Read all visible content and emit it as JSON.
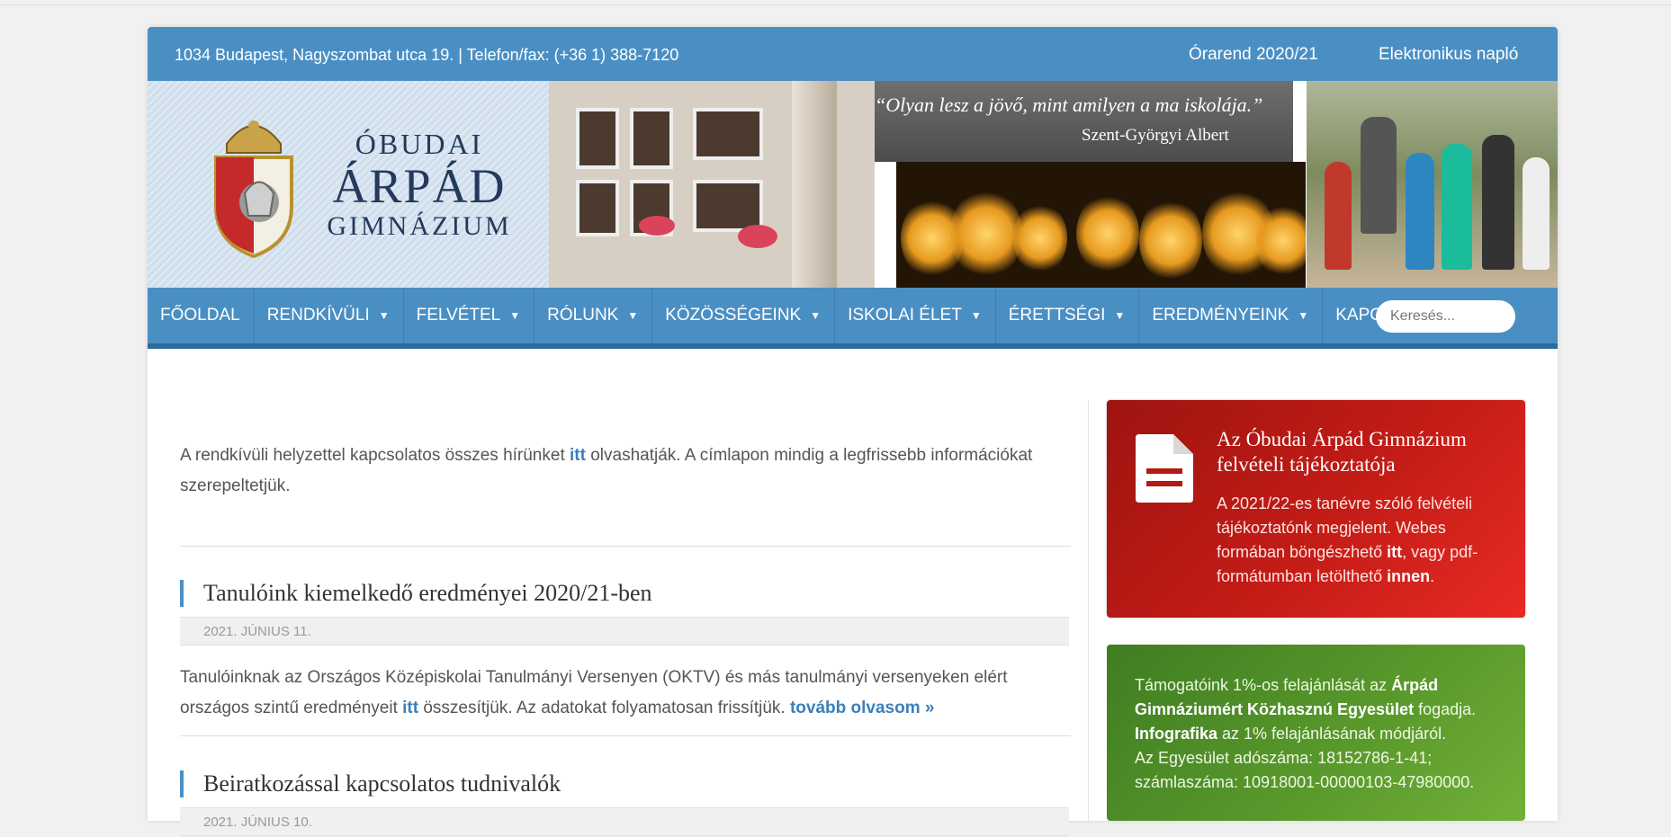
{
  "topbar": {
    "address": "1034 Budapest, Nagyszombat utca 19. | Telefon/fax: (+36 1) 388-7120",
    "timetable_link": "Órarend 2020/21",
    "diary_link": "Elektronikus napló"
  },
  "banner": {
    "logo_line1": "Óbudai",
    "logo_line2": "Árpád",
    "logo_line3": "Gimnázium",
    "quote": "“Olyan lesz a jövő, mint amilyen a ma iskolája.”",
    "quote_author": "Szent-Györgyi Albert"
  },
  "nav": {
    "items": [
      {
        "label": "FŐOLDAL",
        "dropdown": false
      },
      {
        "label": "RENDKÍVÜLI",
        "dropdown": true
      },
      {
        "label": "FELVÉTEL",
        "dropdown": true
      },
      {
        "label": "RÓLUNK",
        "dropdown": true
      },
      {
        "label": "KÖZÖSSÉGEINK",
        "dropdown": true
      },
      {
        "label": "ISKOLAI ÉLET",
        "dropdown": true
      },
      {
        "label": "ÉRETTSÉGI",
        "dropdown": true
      },
      {
        "label": "EREDMÉNYEINK",
        "dropdown": true
      },
      {
        "label": "KAPCSOLAT",
        "dropdown": false
      }
    ],
    "search_placeholder": "Keresés..."
  },
  "main": {
    "intro_before": "A rendkívüli helyzettel kapcsolatos összes hírünket ",
    "intro_link": "itt",
    "intro_after": " olvashatják. A címlapon mindig a legfrissebb információkat szerepeltetjük.",
    "posts": [
      {
        "title": "Tanulóink kiemelkedő eredményei 2020/21-ben",
        "date": "2021. JÚNIUS 11.",
        "body_before": "Tanulóinknak az Országos Középiskolai Tanulmányi Versenyen (OKTV) és más tanulmányi versenyeken elért országos szintű eredményeit ",
        "body_link": "itt",
        "body_after": " összesítjük. Az adatokat folyamatosan frissítjük. ",
        "more": "tovább olvasom »"
      },
      {
        "title": "Beiratkozással kapcsolatos tudnivalók",
        "date": "2021. JÚNIUS 10."
      }
    ]
  },
  "sidebar": {
    "admission_box": {
      "title": "Az Óbudai Árpád Gimnázium felvételi tájékoztatója",
      "text_before": "A 2021/22-es tanévre szóló felvételi tájékoztatónk megjelent. Webes formában böngészhető ",
      "link1": "itt",
      "text_mid": ", vagy pdf-formátumban letölthető ",
      "link2": "innen",
      "text_end": "."
    },
    "support_box": {
      "text1": "Támogatóink 1%-os felajánlását az ",
      "org": "Árpád Gimnáziumért Közhasznú Egyesület",
      "text2": " fogadja.",
      "infographic": "Infografika",
      "text3": " az 1% felajánlásának módjáról.",
      "tax_line": "Az Egyesület adószáma: 18152786-1-41;",
      "account_line": "számlaszáma: 10918001-00000103-47980000."
    }
  }
}
